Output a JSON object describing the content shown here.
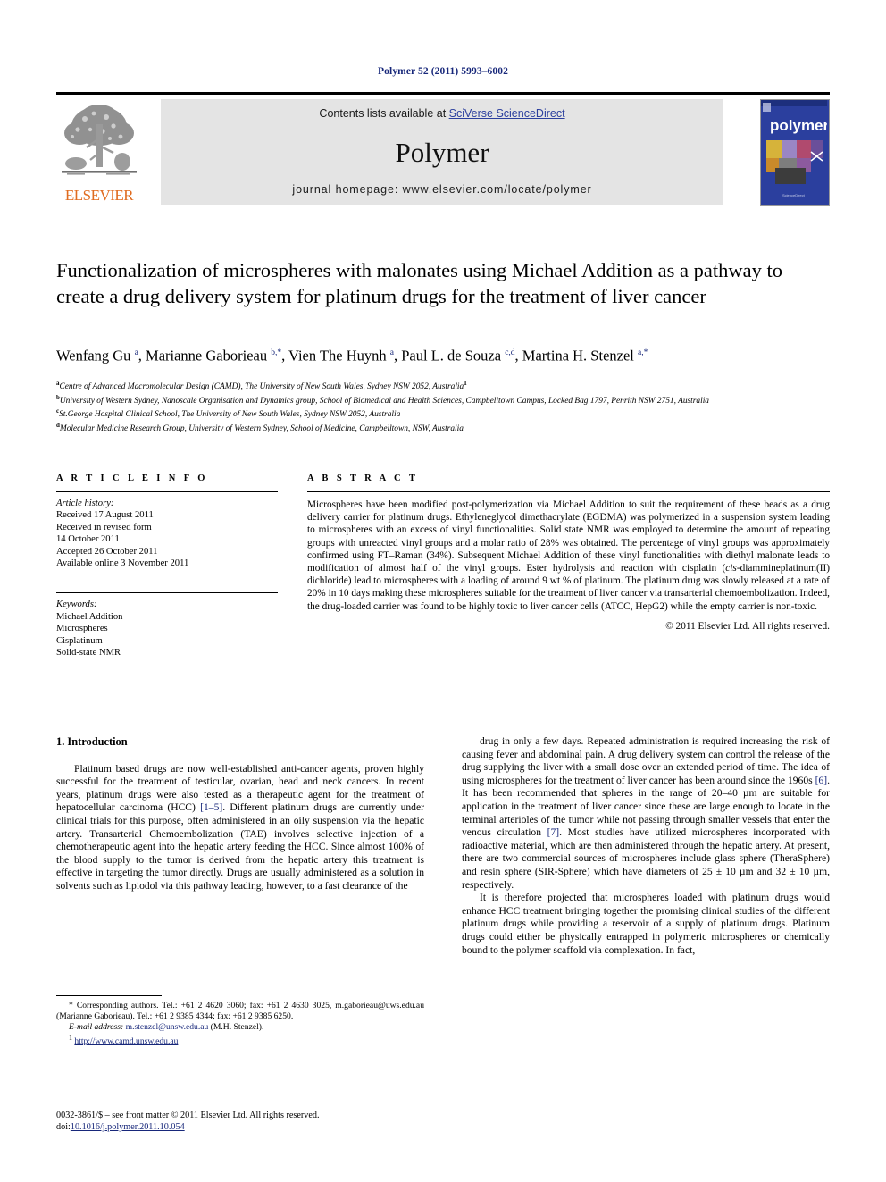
{
  "running_head": "Polymer 52 (2011) 5993–6002",
  "masthead": {
    "publisher_name": "ELSEVIER",
    "contents_prefix": "Contents lists available at ",
    "sciencedirect_link": "SciVerse ScienceDirect",
    "journal_title": "Polymer",
    "homepage_line": "journal homepage: www.elsevier.com/locate/polymer",
    "cover_word": "polymer",
    "accent_link_color": "#2b3f9e",
    "elsevier_orange": "#e06c20"
  },
  "article": {
    "title": "Functionalization of microspheres with malonates using Michael Addition as a pathway to create a drug delivery system for platinum drugs for the treatment of liver cancer",
    "authors_html": "Wenfang Gu <sup>a</sup>, Marianne Gaborieau <sup>b,*</sup>, Vien The Huynh <sup>a</sup>, Paul L. de Souza <sup>c,d</sup>, Martina H. Stenzel <sup>a,*</sup>",
    "affiliations": [
      {
        "marker": "a",
        "text": "Centre of Advanced Macromolecular Design (CAMD), The University of New South Wales, Sydney NSW 2052, Australia<sup>1</sup>"
      },
      {
        "marker": "b",
        "text": "University of Western Sydney, Nanoscale Organisation and Dynamics group, School of Biomedical and Health Sciences, Campbelltown Campus, Locked Bag 1797, Penrith NSW 2751, Australia"
      },
      {
        "marker": "c",
        "text": "St.George Hospital Clinical School, The University of New South Wales, Sydney NSW 2052, Australia"
      },
      {
        "marker": "d",
        "text": "Molecular Medicine Research Group, University of Western Sydney, School of Medicine, Campbelltown, NSW, Australia"
      }
    ]
  },
  "article_info": {
    "heading": "A R T I C L E   I N F O",
    "history_label": "Article history:",
    "history": [
      "Received 17 August 2011",
      "Received in revised form",
      "14 October 2011",
      "Accepted 26 October 2011",
      "Available online 3 November 2011"
    ],
    "keywords_label": "Keywords:",
    "keywords": [
      "Michael Addition",
      "Microspheres",
      "Cisplatinum",
      "Solid-state NMR"
    ]
  },
  "abstract": {
    "heading": "A B S T R A C T",
    "body_html": "Microspheres have been modified post-polymerization via Michael Addition to suit the requirement of these beads as a drug delivery carrier for platinum drugs. Ethyleneglycol dimethacrylate (EGDMA) was polymerized in a suspension system leading to microspheres with an excess of vinyl functionalities. Solid state NMR was employed to determine the amount of repeating groups with unreacted vinyl groups and a molar ratio of 28% was obtained. The percentage of vinyl groups was approximately confirmed using FT&#8211;Raman (34%). Subsequent Michael Addition of these vinyl functionalities with diethyl malonate leads to modification of almost half of the vinyl groups. Ester hydrolysis and reaction with cisplatin (<i>cis</i>-diammineplatinum(II) dichloride) lead to microspheres with a loading of around 9 wt % of platinum. The platinum drug was slowly released at a rate of 20% in 10 days making these microspheres suitable for the treatment of liver cancer via transarterial chemoembolization. Indeed, the drug-loaded carrier was found to be highly toxic to liver cancer cells (ATCC, HepG2) while the empty carrier is non-toxic.",
    "copyright": "© 2011 Elsevier Ltd. All rights reserved."
  },
  "introduction": {
    "heading": "1. Introduction",
    "left_paragraphs_html": [
      "Platinum based drugs are now well-established anti-cancer agents, proven highly successful for the treatment of testicular, ovarian, head and neck cancers. In recent years, platinum drugs were also tested as a therapeutic agent for the treatment of hepatocellular carcinoma (HCC) <span class=\"ref\">[1&#8211;5]</span>. Different platinum drugs are currently under clinical trials for this purpose, often administered in an oily suspension via the hepatic artery. Transarterial Chemoembolization (TAE) involves selective injection of a chemotherapeutic agent into the hepatic artery feeding the HCC. Since almost 100% of the blood supply to the tumor is derived from the hepatic artery this treatment is effective in targeting the tumor directly. Drugs are usually administered as a solution in solvents such as lipiodol via this pathway leading, however, to a fast clearance of the"
    ],
    "right_paragraphs_html": [
      "drug in only a few days. Repeated administration is required increasing the risk of causing fever and abdominal pain. A drug delivery system can control the release of the drug supplying the liver with a small dose over an extended period of time. The idea of using microspheres for the treatment of liver cancer has been around since the 1960s <span class=\"ref\">[6]</span>. It has been recommended that spheres in the range of 20&#8211;40 &#181;m are suitable for application in the treatment of liver cancer since these are large enough to locate in the terminal arterioles of the tumor while not passing through smaller vessels that enter the venous circulation <span class=\"ref\">[7]</span>. Most studies have utilized microspheres incorporated with radioactive material, which are then administered through the hepatic artery. At present, there are two commercial sources of microspheres include glass sphere (TheraSphere) and resin sphere (SIR-Sphere) which have diameters of 25 &#177; 10 &#181;m and 32 &#177; 10 &#181;m, respectively.",
      "It is therefore projected that microspheres loaded with platinum drugs would enhance HCC treatment bringing together the promising clinical studies of the different platinum drugs while providing a reservoir of a supply of platinum drugs. Platinum drugs could either be physically entrapped in polymeric microspheres or chemically bound to the polymer scaffold via complexation. In fact,"
    ]
  },
  "footnotes": {
    "corresponding_html": "* Corresponding authors. Tel.:  +61 2 4620 3060; fax:  +61 2 4630 3025, m.gaborieau@uws.edu.au (Marianne Gaborieau). Tel.: +61 2 9385 4344; fax: +61 2 9385 6250.",
    "email_label": "E-mail address:",
    "email_html": "<span class=\"lnk\">m.stenzel@unsw.edu.au</span> (M.H. Stenzel).",
    "note_marker": "1",
    "note_url": "http://www.camd.unsw.edu.au"
  },
  "imprint": {
    "line1_html": "0032-3861/$ &#8211; see front matter &#169; 2011 Elsevier Ltd. All rights reserved.",
    "doi_label": "doi:",
    "doi_value": "10.1016/j.polymer.2011.10.054"
  }
}
